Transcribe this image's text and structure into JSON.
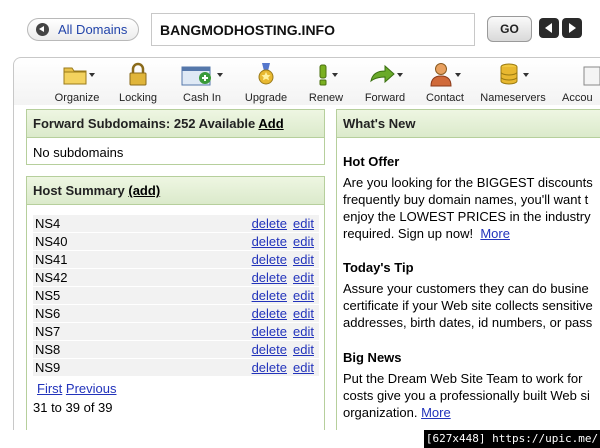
{
  "topbar": {
    "all_domains_label": "All Domains",
    "domain": "BANGMODHOSTING.INFO",
    "go_label": "GO"
  },
  "toolbar": {
    "items": [
      {
        "label": "Organize",
        "icon": "folder-icon"
      },
      {
        "label": "Locking",
        "icon": "padlock-icon"
      },
      {
        "label": "Cash In",
        "icon": "cash-in-icon"
      },
      {
        "label": "Upgrade",
        "icon": "medal-icon"
      },
      {
        "label": "Renew",
        "icon": "exclamation-icon"
      },
      {
        "label": "Forward",
        "icon": "forward-arrow-icon"
      },
      {
        "label": "Contact",
        "icon": "person-icon"
      },
      {
        "label": "Nameservers",
        "icon": "database-icon"
      },
      {
        "label": "Accou",
        "icon": "account-icon"
      }
    ]
  },
  "forward_panel": {
    "title": "Forward Subdomains: 252 Available",
    "add_label": "Add",
    "body": "No subdomains"
  },
  "host_panel": {
    "title": "Host Summary",
    "add_label": "(add)",
    "delete_label": "delete",
    "edit_label": "edit",
    "rows": [
      "NS4",
      "NS40",
      "NS41",
      "NS42",
      "NS5",
      "NS6",
      "NS7",
      "NS8",
      "NS9"
    ],
    "first_label": "First",
    "previous_label": "Previous",
    "count_text": "31 to 39 of 39"
  },
  "news_panel": {
    "title": "What's New",
    "sections": [
      {
        "heading": "Hot Offer",
        "lines": [
          "Are you looking for the BIGGEST discounts",
          "frequently buy domain names, you'll want t",
          "enjoy the LOWEST PRICES in the industry",
          "required. Sign up now!"
        ],
        "more": "More"
      },
      {
        "heading": "Today's Tip",
        "lines": [
          "Assure your customers they can do busine",
          "certificate if your Web site collects sensitive",
          "addresses, birth dates, id numbers, or pass"
        ]
      },
      {
        "heading": "Big News",
        "lines": [
          "Put the Dream Web Site Team to work for",
          "costs give you a professionally built Web si",
          "organization."
        ],
        "more": "More"
      }
    ]
  },
  "watermark": "[627x448] https://upic.me/",
  "colors": {
    "panel_header": "#dbeacb",
    "panel_border": "#b6cf9c",
    "link": "#2233bb"
  }
}
